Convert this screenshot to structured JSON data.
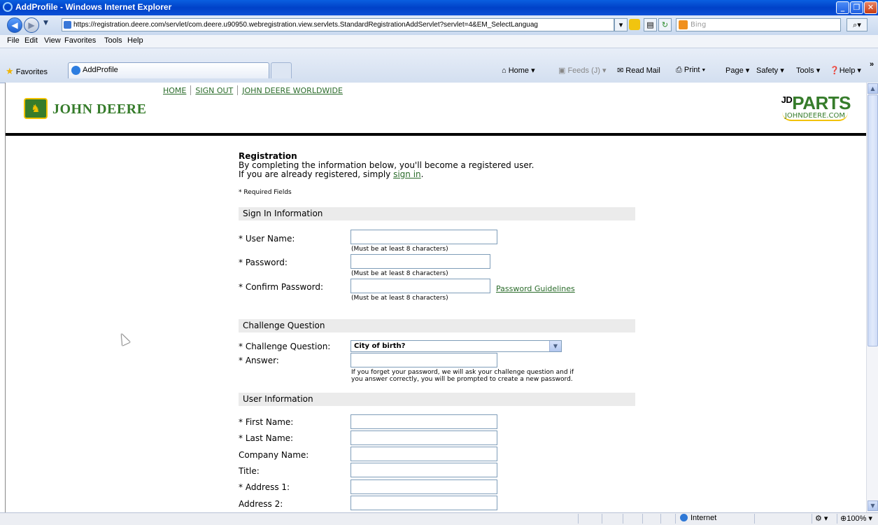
{
  "window": {
    "title": "AddProfile - Windows Internet Explorer"
  },
  "address": {
    "url": "https://registration.deere.com/servlet/com.deere.u90950.webregistration.view.servlets.StandardRegistrationAddServlet?servlet=4&EM_SelectLanguag",
    "search_placeholder": "Bing"
  },
  "menu": {
    "file": "File",
    "edit": "Edit",
    "view": "View",
    "favorites": "Favorites",
    "tools": "Tools",
    "help": "Help"
  },
  "toolbar": {
    "favorites": "Favorites",
    "tab_label": "AddProfile",
    "home": "Home",
    "feeds": "Feeds (J)",
    "read_mail": "Read Mail",
    "print": "Print",
    "page": "Page",
    "safety": "Safety",
    "tools": "Tools",
    "help": "Help"
  },
  "header": {
    "nav_home": "HOME",
    "nav_signout": "SIGN OUT",
    "nav_worldwide": "JOHN DEERE WORLDWIDE",
    "brand": "JOHN DEERE",
    "jdparts_prefix": "JD",
    "jdparts": "PARTS",
    "jdparts_domain": "JOHNDEERE.COM"
  },
  "form": {
    "heading": "Registration",
    "intro_line1": "By completing the information below, you'll become a registered user.",
    "intro_line2": "If you are already registered, simply ",
    "sign_in_link": "sign in",
    "intro_end": ".",
    "required_note": "* Required Fields",
    "section_signin": "Sign In Information",
    "user_name_label": "* User Name:",
    "password_label": "* Password:",
    "confirm_password_label": "* Confirm Password:",
    "min_chars_hint": "(Must be at least 8 characters)",
    "password_guidelines_link": "Password Guidelines",
    "section_challenge": "Challenge Question",
    "challenge_label": "* Challenge Question:",
    "challenge_value": "City of birth?",
    "answer_label": "* Answer:",
    "answer_hint_1": "If you forget your password, we will ask your challenge question and if",
    "answer_hint_2": "you answer correctly, you will be prompted to create a new password.",
    "section_user": "User Information",
    "first_name_label": "* First Name:",
    "last_name_label": "* Last Name:",
    "company_label": "Company Name:",
    "title_label": "Title:",
    "address1_label": "* Address 1:",
    "address2_label": "Address 2:"
  },
  "status": {
    "zone": "Internet",
    "zoom": "100%"
  }
}
